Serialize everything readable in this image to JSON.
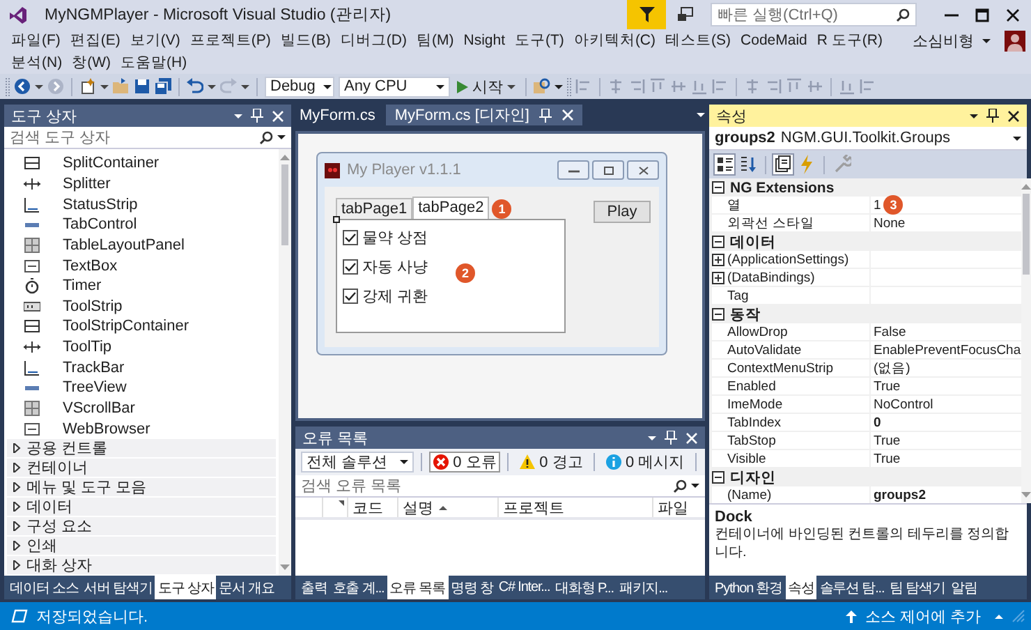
{
  "window": {
    "title": "MyNGMPlayer - Microsoft Visual Studio  (관리자)"
  },
  "quick_launch": {
    "placeholder": "빠른 실행(Ctrl+Q)"
  },
  "menu_rows": [
    [
      "파일(F)",
      "편집(E)",
      "보기(V)",
      "프로젝트(P)",
      "빌드(B)",
      "디버그(D)",
      "팀(M)",
      "Nsight",
      "도구(T)",
      "아키텍처(C)",
      "테스트(S)",
      "CodeMaid",
      "R 도구(R)"
    ],
    [
      "분석(N)",
      "창(W)",
      "도움말(H)"
    ]
  ],
  "account": {
    "name": "소심비형"
  },
  "toolbar": {
    "configuration": "Debug",
    "platform": "Any CPU",
    "start": "시작"
  },
  "toolbox": {
    "title": "도구 상자",
    "search": {
      "placeholder": "검색 도구 상자"
    },
    "items": [
      "SplitContainer",
      "Splitter",
      "StatusStrip",
      "TabControl",
      "TableLayoutPanel",
      "TextBox",
      "Timer",
      "ToolStrip",
      "ToolStripContainer",
      "ToolTip",
      "TrackBar",
      "TreeView",
      "VScrollBar",
      "WebBrowser"
    ],
    "categories": [
      {
        "label": "공용 컨트롤",
        "expanded": false
      },
      {
        "label": "컨테이너",
        "expanded": false
      },
      {
        "label": "메뉴 및 도구 모음",
        "expanded": false
      },
      {
        "label": "데이터",
        "expanded": false
      },
      {
        "label": "구성 요소",
        "expanded": false
      },
      {
        "label": "인쇄",
        "expanded": false
      },
      {
        "label": "대화 상자",
        "expanded": false
      }
    ],
    "tabs": [
      {
        "label": "데이터 소스",
        "selected": false
      },
      {
        "label": "서버 탐색기",
        "selected": false
      },
      {
        "label": "도구 상자",
        "selected": true
      },
      {
        "label": "문서 개요",
        "selected": false
      }
    ]
  },
  "documents": {
    "tabs": [
      {
        "label": "MyForm.cs",
        "selected": false
      },
      {
        "label": "MyForm.cs [디자인]",
        "selected": true
      }
    ]
  },
  "designer": {
    "form_title": "My Player v1.1.1",
    "tabs": [
      {
        "label": "tabPage1",
        "selected": false
      },
      {
        "label": "tabPage2",
        "selected": true,
        "callout": "1"
      }
    ],
    "group_callout": "2",
    "checkboxes": [
      {
        "label": "물약 상점",
        "checked": true
      },
      {
        "label": "자동 사냥",
        "checked": true
      },
      {
        "label": "강제 귀환",
        "checked": true
      }
    ],
    "play_button": "Play"
  },
  "error_list": {
    "title": "오류 목록",
    "scope": "전체 솔루션",
    "filters": [
      {
        "kind": "error",
        "label": "0 오류",
        "selected": true
      },
      {
        "kind": "warning",
        "label": "0 경고",
        "selected": false
      },
      {
        "kind": "message",
        "label": "0 메시지",
        "selected": false
      }
    ],
    "search": {
      "placeholder": "검색 오류 목록"
    },
    "columns": [
      {
        "label": "코드"
      },
      {
        "label": "설명",
        "sorted": true
      },
      {
        "label": "프로젝트"
      },
      {
        "label": "파일"
      }
    ],
    "tabs": [
      {
        "label": "출력",
        "selected": false
      },
      {
        "label": "호출 계...",
        "selected": false
      },
      {
        "label": "오류 목록",
        "selected": true
      },
      {
        "label": "명령 창",
        "selected": false
      },
      {
        "label": "C# Inter...",
        "selected": false
      },
      {
        "label": "대화형 P...",
        "selected": false
      },
      {
        "label": "패키지...",
        "selected": false
      }
    ]
  },
  "properties": {
    "title": "속성",
    "object": "groups2",
    "type": "NGM.GUI.Toolkit.Groups",
    "categories": [
      {
        "label": "NG Extensions",
        "expanded": true,
        "rows": [
          {
            "name": "열",
            "value": "1",
            "callout": "3"
          },
          {
            "name": "외곽선 스타일",
            "value": "None"
          }
        ]
      },
      {
        "label": "데이터",
        "expanded": true,
        "rows": [
          {
            "name": "(ApplicationSettings)",
            "expanded": false
          },
          {
            "name": "(DataBindings)",
            "expanded": false
          },
          {
            "name": "Tag"
          }
        ]
      },
      {
        "label": "동작",
        "expanded": true,
        "rows": [
          {
            "name": "AllowDrop",
            "value": "False"
          },
          {
            "name": "AutoValidate",
            "value": "EnablePreventFocusCha"
          },
          {
            "name": "ContextMenuStrip",
            "value": "(없음)"
          },
          {
            "name": "Enabled",
            "value": "True"
          },
          {
            "name": "ImeMode",
            "value": "NoControl"
          },
          {
            "name": "TabIndex",
            "value": "0",
            "non_default": true
          },
          {
            "name": "TabStop",
            "value": "True"
          },
          {
            "name": "Visible",
            "value": "True"
          }
        ]
      },
      {
        "label": "디자인",
        "expanded": true,
        "rows": [
          {
            "name": "(Name)",
            "value": "groups2",
            "non_default": true
          }
        ]
      }
    ],
    "description": {
      "title": "Dock",
      "text": "컨테이너에 바인딩된 컨트롤의 테두리를 정의합니다."
    },
    "tabs": [
      {
        "label": "Python 환경",
        "selected": false
      },
      {
        "label": "속성",
        "selected": true
      },
      {
        "label": "솔루션 탐...",
        "selected": false
      },
      {
        "label": "팀 탐색기",
        "selected": false
      },
      {
        "label": "알림",
        "selected": false
      }
    ]
  },
  "status_bar": {
    "message": "저장되었습니다.",
    "source_control": "소스 제어에 추가"
  }
}
